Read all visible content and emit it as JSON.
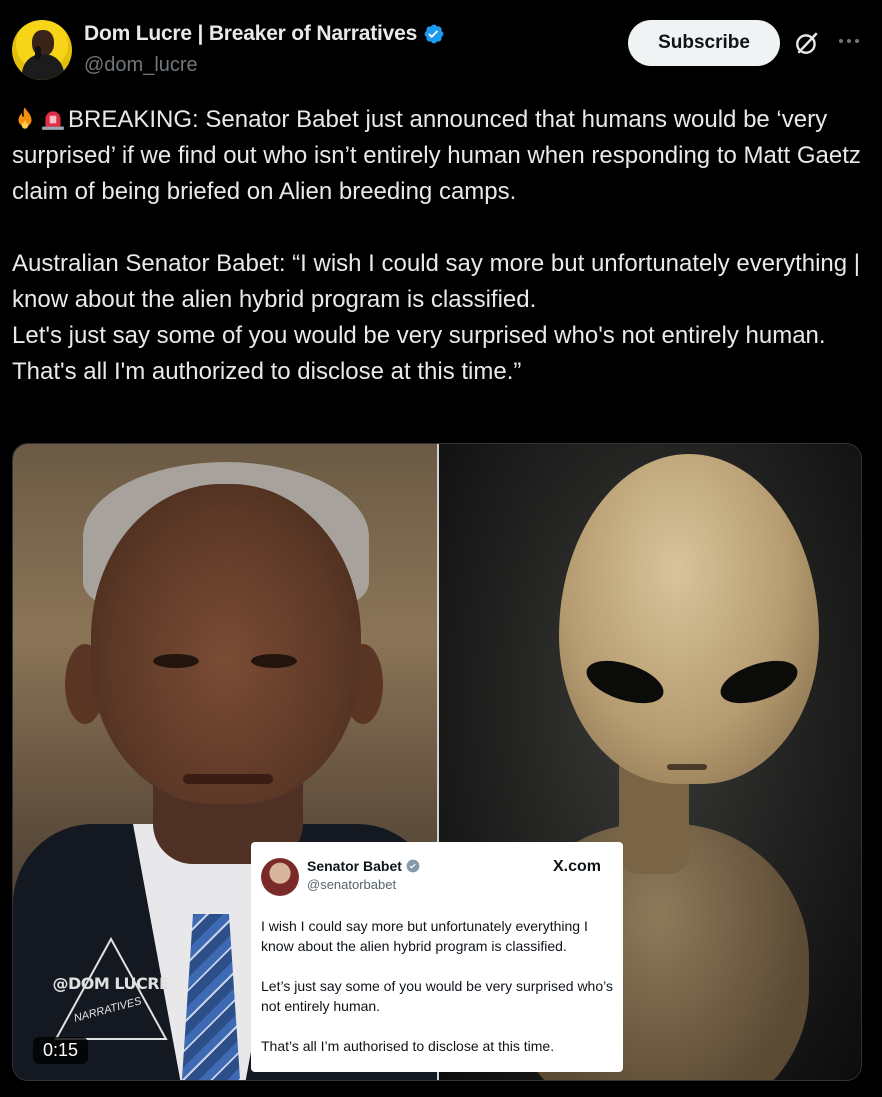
{
  "author": {
    "display_name": "Dom Lucre | Breaker of Narratives",
    "handle": "@dom_lucre",
    "verified": true,
    "avatar": "avatar-man-with-microphone"
  },
  "actions": {
    "subscribe_label": "Subscribe",
    "grok_icon": "grok-icon",
    "more_icon": "more-options-icon"
  },
  "tweet": {
    "emojis": [
      "fire-emoji",
      "police-light-emoji"
    ],
    "text": "BREAKING: Senator Babet just announced that humans would be ‘very surprised’ if we find out who isn’t entirely human when responding to Matt Gaetz claim of being briefed on Alien breeding camps.\n\nAustralian Senator Babet: “I wish I could say more but unfortunately everything | know about the alien hybrid program is classified.\nLet's just say some of you would be very surprised who's not entirely human.\nThat's all I'm authorized to disclose at this time.”"
  },
  "media": {
    "duration": "0:15",
    "watermark_main": "@DOM LUCRE",
    "watermark_sub": "NARRATIVES",
    "inner_card": {
      "name": "Senator Babet",
      "handle": "@senatorbabet",
      "brand": "X.com",
      "p1": "I wish I could say more but unfortunately everything I know about the alien hybrid program is classified.",
      "p2": "Let’s just say some of you would be very surprised who’s not entirely human.",
      "p3": "That’s all I’m authorised to disclose at this time."
    }
  },
  "colors": {
    "background": "#000000",
    "text": "#e7e9ea",
    "secondary_text": "#71767b",
    "verified_blue": "#1d9bf0",
    "subscribe_bg": "#eff3f4"
  }
}
